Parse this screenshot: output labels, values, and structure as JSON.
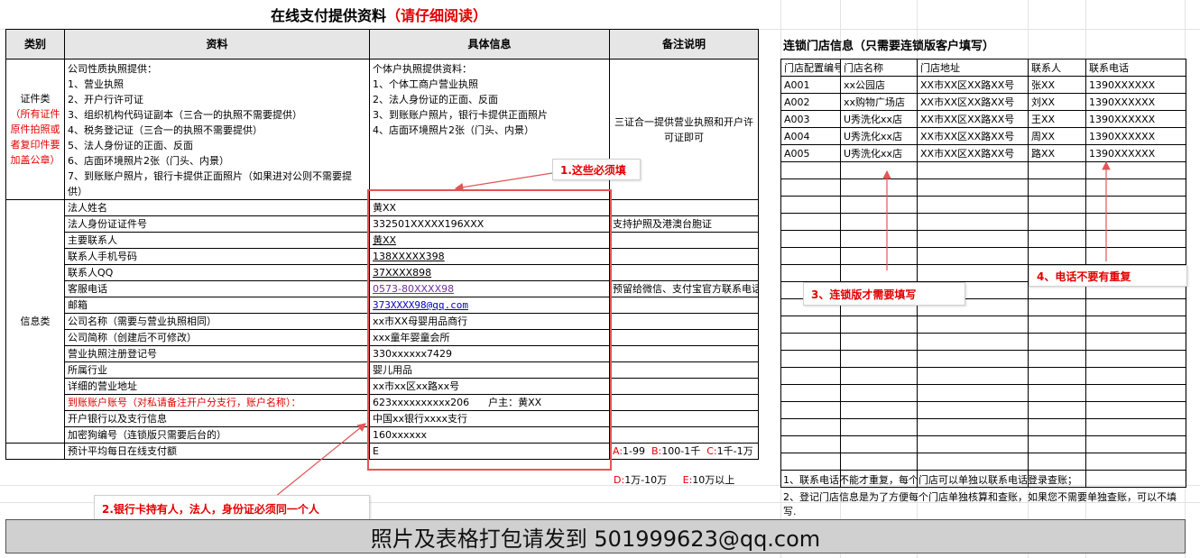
{
  "title": {
    "main": "在线支付提供资料",
    "emphasis": "（请仔细阅读）"
  },
  "headers": {
    "category": "类别",
    "material": "资料",
    "detail": "具体信息",
    "remark": "备注说明"
  },
  "cert": {
    "category_label": "证件类",
    "category_note": "（所有证件原件拍照或者复印件要加盖公章）",
    "company_lines": [
      "公司性质执照提供：",
      "1、营业执照",
      "2、开户行许可证",
      "3、组织机构代码证副本（三合一的执照不需要提供）",
      "4、税务登记证（三合一的执照不需要提供）",
      "5、法人身份证的正面、反面",
      "6、店面环境照片2张（门头、内景）",
      "7、到账账户照片，银行卡提供正面照片（如果进对公则不需要提供）"
    ],
    "individual_lines": [
      "个体户执照提供资料：",
      "1、个体工商户营业执照",
      "2、法人身份证的正面、反面",
      "3、到账账户照片，银行卡提供正面照片",
      "4、店面环境照片2张（门头、内景）"
    ],
    "remark": "三证合一提供营业执照和开户许可证即可"
  },
  "info": {
    "category_label": "信息类",
    "rows": [
      {
        "label": "法人姓名",
        "value": "黄XX",
        "remark": ""
      },
      {
        "label": "法人身份证证件号",
        "value": "332501XXXXX196XXX",
        "remark": "支持护照及港澳台胞证"
      },
      {
        "label": "主要联系人",
        "value": "黄XX",
        "remark": ""
      },
      {
        "label": "联系人手机号码",
        "value": "138XXXXX398",
        "remark": ""
      },
      {
        "label": "联系人QQ",
        "value": "37XXXX898",
        "remark": ""
      },
      {
        "label": "客服电话",
        "value": "0573-80XXXX98",
        "remark": "预留给微信、支付宝官方联系电话"
      },
      {
        "label": "邮箱",
        "value": "373XXXX98@qq.com",
        "remark": ""
      },
      {
        "label": "公司名称（需要与营业执照相同）",
        "value": "xx市XX母婴用品商行",
        "remark": ""
      },
      {
        "label": "公司简称（创建后不可修改）",
        "value": "xxx童年婴童会所",
        "remark": ""
      },
      {
        "label": "营业执照注册登记号",
        "value": "330xxxxxx7429",
        "remark": ""
      },
      {
        "label": "所属行业",
        "value": "婴儿用品",
        "remark": ""
      },
      {
        "label": "详细的营业地址",
        "value": "xx市xx区xx路xx号",
        "remark": ""
      },
      {
        "label": "到账账户账号（对私请备注开户分支行，账户名称）：",
        "value": "623xxxxxxxxxx206",
        "value_extra": "户主：黄XX",
        "remark": ""
      },
      {
        "label": "开户银行以及支行信息",
        "value": "中国xx银行xxxx支行",
        "remark": ""
      },
      {
        "label": "加密狗编号（连锁版只需要后台的）",
        "value": "160xxxxxx",
        "remark": ""
      }
    ]
  },
  "budget": {
    "label": "预计平均每日在线支付额",
    "value": "E",
    "options_row1": [
      {
        "key": "A:",
        "text": "1-99"
      },
      {
        "key": "B:",
        "text": "100-1千"
      },
      {
        "key": "C:",
        "text": "1千-1万"
      }
    ],
    "options_row2": [
      {
        "key": "D:",
        "text": "1万-10万"
      },
      {
        "key": "E:",
        "text": "10万以上"
      }
    ]
  },
  "store": {
    "title": "连锁门店信息（只需要连锁版客户填写）",
    "columns": [
      "门店配置编号",
      "门店名称",
      "门店地址",
      "联系人",
      "联系电话"
    ],
    "rows": [
      [
        "A001",
        "xx公园店",
        "XX市XX区XX路XX号",
        "张XX",
        "1390XXXXXX"
      ],
      [
        "A002",
        "xx购物广场店",
        "XX市XX区XX路XX号",
        "刘XX",
        "1390XXXXXX"
      ],
      [
        "A003",
        "U秀洗化xx店",
        "XX市XX区XX路XX号",
        "王XX",
        "1390XXXXXX"
      ],
      [
        "A004",
        "U秀洗化xx店",
        "XX市XX区XX路XX号",
        "周XX",
        "1390XXXXXX"
      ],
      [
        "A005",
        "U秀洗化xx店",
        "XX市XX区XX路XX号",
        "路XX",
        "1390XXXXXX"
      ]
    ],
    "notes": [
      "1、联系电话不能才重复，每个门店可以单独以联系电话登录查账；",
      "2、登记门店信息是为了方便每个门店单独核算和查账，如果您不需要单独查账，可以不填",
      "写."
    ]
  },
  "callouts": {
    "c1": "1.这些必须填",
    "c2": "2.银行卡持有人，法人，身份证必须同一个人",
    "c3": "3、连锁版才需要填写",
    "c4": "4、电话不要有重复"
  },
  "footer": "照片及表格打包请发到 501999623@qq.com",
  "colors": {
    "accent_red": "#e00000",
    "header_gray": "#e6e6e6",
    "footer_gray": "#d0d0d0",
    "link_purple": "#7030a0"
  }
}
